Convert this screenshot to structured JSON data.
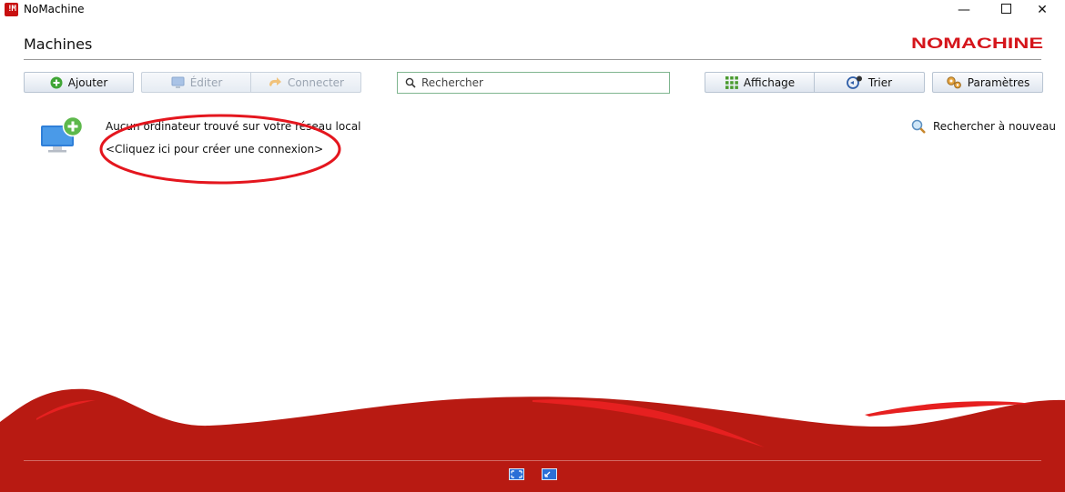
{
  "window": {
    "app_icon_text": "!M",
    "title": "NoMachine",
    "minimize_glyph": "—",
    "close_glyph": "✕"
  },
  "header": {
    "title": "Machines",
    "brand": "NOMACHINE",
    "brand_color": "#d5151b"
  },
  "toolbar": {
    "add_label": "Ajouter",
    "edit_label": "Éditer",
    "connect_label": "Connecter",
    "view_label": "Affichage",
    "sort_label": "Trier",
    "settings_label": "Paramètres"
  },
  "search": {
    "placeholder": "Rechercher",
    "value": ""
  },
  "content": {
    "no_computer_message": "Aucun ordinateur trouvé sur votre réseau local",
    "create_connection_link": "<Cliquez ici pour créer une connexion>",
    "rescan_label": "Rechercher à nouveau"
  },
  "colors": {
    "footer_red": "#b81a12",
    "annotation_red": "#e4161e",
    "add_green": "#3fa535"
  },
  "icons": {
    "add": "plus-circle-icon",
    "edit": "monitor-icon",
    "connect": "connect-arrow-icon",
    "view": "grid-icon",
    "sort": "sort-icon",
    "settings": "gears-icon",
    "search": "search-icon",
    "rescan": "magnifier-icon",
    "fullscreen": "fullscreen-icon",
    "resize": "resize-icon"
  }
}
